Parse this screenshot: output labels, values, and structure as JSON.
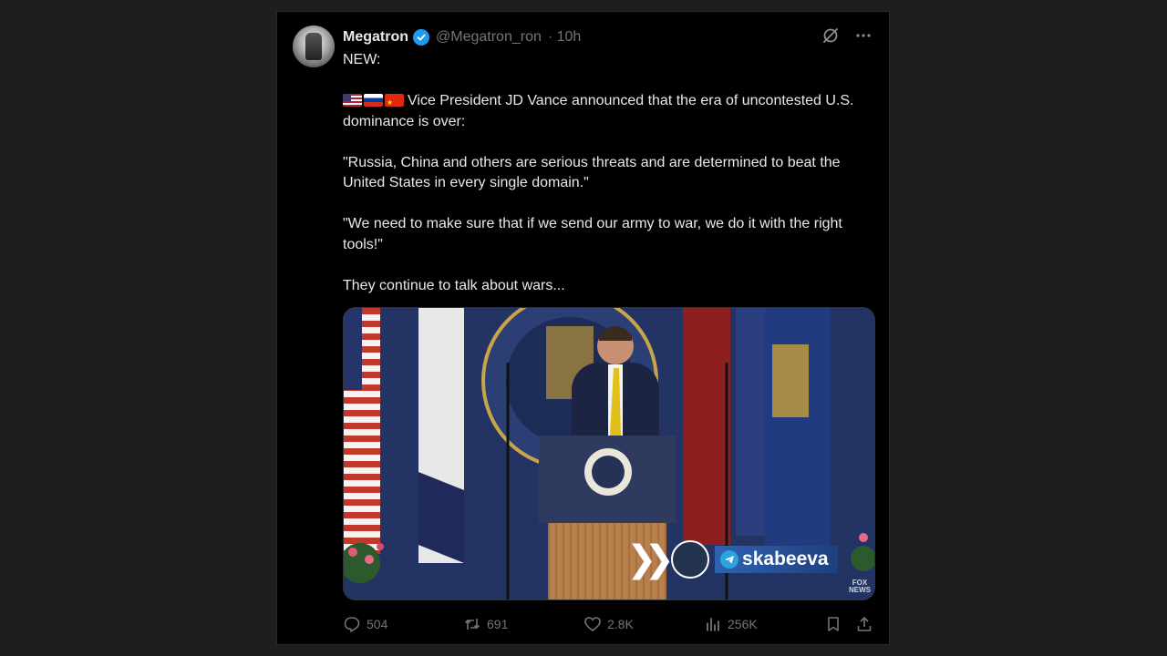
{
  "tweet": {
    "author_name": "Megatron",
    "handle": "@Megatron_ron",
    "time": "· 10h",
    "line_new": "NEW:",
    "line_announce": "Vice President JD Vance announced that the era of uncontested U.S. dominance is over:",
    "line_quote1": "\"Russia, China and others are serious threats and are determined to beat the United States in every single domain.\"",
    "line_quote2": "\"We need to make sure that if we send our army to war, we do it with the right tools!\"",
    "line_closing": "They continue to talk about wars...",
    "flags": [
      "us-flag-icon",
      "russia-flag-icon",
      "china-flag-icon"
    ]
  },
  "media": {
    "watermark_handle": "skabeeva",
    "corner_logo_lines": [
      "FOX",
      "NEWS"
    ]
  },
  "actions": {
    "replies": "504",
    "reposts": "691",
    "likes": "2.8K",
    "views": "256K"
  },
  "colors": {
    "background": "#1e1e1e",
    "card": "#000000",
    "text": "#e7e9ea",
    "muted": "#71767b",
    "verified": "#1d9bf0"
  }
}
